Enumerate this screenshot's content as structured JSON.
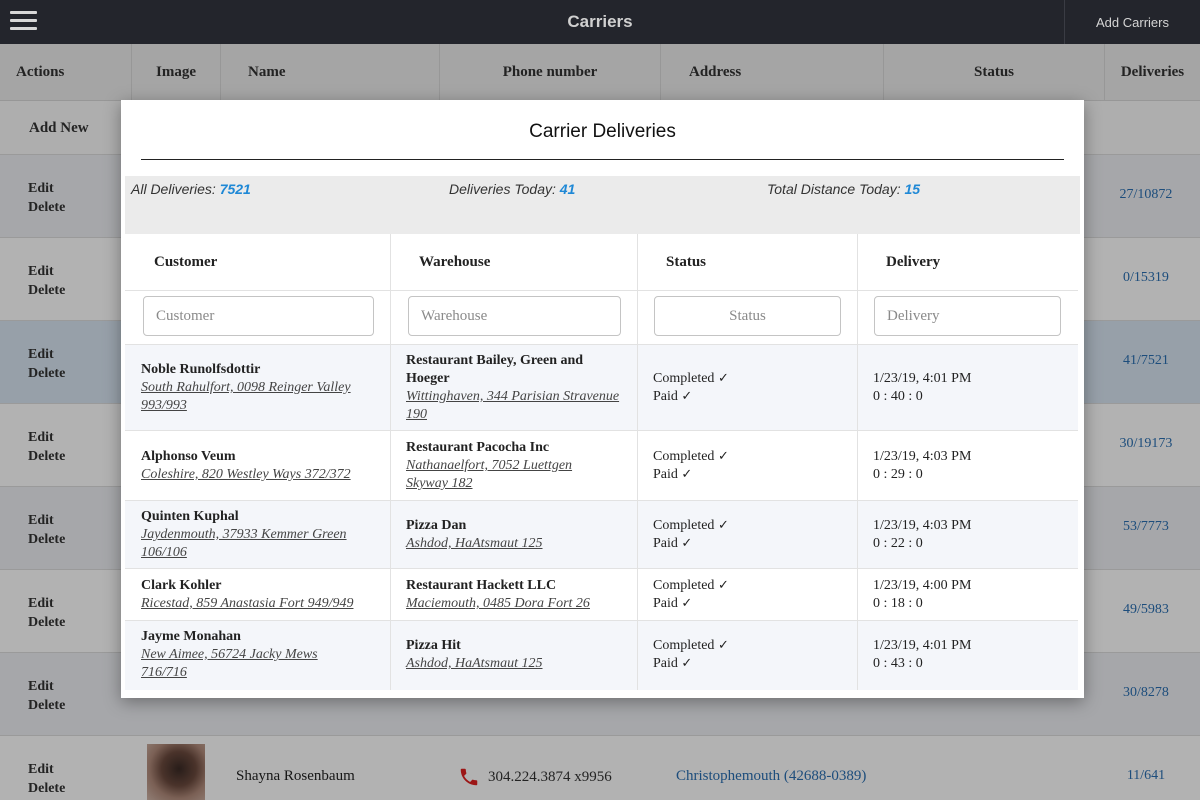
{
  "app": {
    "title": "Carriers",
    "add_button": "Add Carriers"
  },
  "background_table": {
    "headers": [
      "Actions",
      "Image",
      "Name",
      "Phone number",
      "Address",
      "Status",
      "Deliveries"
    ],
    "add_new": "Add New",
    "edit_label": "Edit",
    "delete_label": "Delete",
    "deliveries": [
      "27/10872",
      "0/15319",
      "41/7521",
      "30/19173",
      "53/7773",
      "49/5983",
      "30/8278",
      "11/641"
    ],
    "last_row": {
      "name": "Shayna Rosenbaum",
      "phone": "304.224.3874 x9956",
      "address": "Christophemouth (42688-0389)"
    }
  },
  "modal": {
    "title": "Carrier Deliveries",
    "stats": {
      "all_label": "All Deliveries:",
      "all_value": "7521",
      "today_label": "Deliveries Today:",
      "today_value": "41",
      "distance_label": "Total Distance Today:",
      "distance_value": "15"
    },
    "columns": [
      "Customer",
      "Warehouse",
      "Status",
      "Delivery"
    ],
    "filters": [
      "Customer",
      "Warehouse",
      "Status",
      "Delivery"
    ],
    "completed_label": "Completed",
    "paid_label": "Paid",
    "check_glyph": "✓",
    "rows": [
      {
        "customer": "Noble Runolfsdottir",
        "customer_address": "South Rahulfort, 0098 Reinger Valley 993/993",
        "warehouse": "Restaurant Bailey, Green and Hoeger",
        "warehouse_address": "Wittinghaven, 344 Parisian Stravenue 190",
        "date": "1/23/19, 4:01 PM",
        "duration": "0 : 40 : 0"
      },
      {
        "customer": "Alphonso Veum",
        "customer_address": "Coleshire, 820 Westley Ways 372/372",
        "warehouse": "Restaurant Pacocha Inc",
        "warehouse_address": "Nathanaelfort, 7052 Luettgen Skyway 182",
        "date": "1/23/19, 4:03 PM",
        "duration": "0 : 29 : 0"
      },
      {
        "customer": "Quinten Kuphal",
        "customer_address": "Jaydenmouth, 37933 Kemmer Green 106/106",
        "warehouse": "Pizza Dan",
        "warehouse_address": "Ashdod, HaAtsmaut 125",
        "date": "1/23/19, 4:03 PM",
        "duration": "0 : 22 : 0"
      },
      {
        "customer": "Clark Kohler",
        "customer_address": "Ricestad, 859 Anastasia Fort 949/949",
        "warehouse": "Restaurant Hackett LLC",
        "warehouse_address": "Maciemouth, 0485 Dora Fort 26",
        "date": "1/23/19, 4:00 PM",
        "duration": "0 : 18 : 0"
      },
      {
        "customer": "Jayme Monahan",
        "customer_address": "New Aimee, 56724 Jacky Mews 716/716",
        "warehouse": "Pizza Hit",
        "warehouse_address": "Ashdod, HaAtsmaut 125",
        "date": "1/23/19, 4:01 PM",
        "duration": "0 : 43 : 0"
      }
    ]
  }
}
